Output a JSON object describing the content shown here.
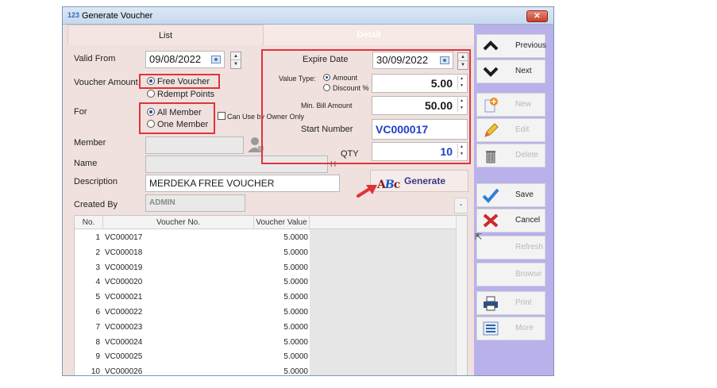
{
  "window": {
    "app_icon": "123",
    "title": "Generate Voucher",
    "close_label": "✕"
  },
  "tabs": [
    {
      "label": "List"
    },
    {
      "label": "Detail"
    }
  ],
  "form": {
    "valid_from_label": "Valid From",
    "valid_from": "09/08/2022",
    "voucher_amount_label": "Voucher Amount",
    "voucher_amount_options": [
      "Free Voucher",
      "Rdempt Points"
    ],
    "for_label": "For",
    "for_options": [
      "All Member",
      "One Member"
    ],
    "can_use_by_owner_label": "Can Use by Owner Only",
    "member_label": "Member",
    "member_value": "",
    "name_label": "Name",
    "name_value": "",
    "name_suffix": "H",
    "description_label": "Description",
    "description_value": "MERDEKA FREE VOUCHER",
    "created_by_label": "Created By",
    "created_by_value": "ADMIN"
  },
  "detail": {
    "expire_date_label": "Expire Date",
    "expire_date": "30/09/2022",
    "value_type_label": "Value Type:",
    "value_type_options": [
      "Amount",
      "Discount %"
    ],
    "value": "5.00",
    "min_bill_label": "Min. Bill Amount",
    "min_bill_value": "50.00",
    "start_number_label": "Start Number",
    "start_number_value": "VC000017",
    "qty_label": "QTY",
    "qty_value": "10",
    "generate_label": "Generate",
    "generate_icon_text": [
      "A",
      "B",
      "c"
    ]
  },
  "grid": {
    "columns": [
      "No.",
      "Voucher No.",
      "Voucher Value"
    ],
    "rows": [
      {
        "no": "1",
        "voucher_no": "VC000017",
        "value": "5.0000"
      },
      {
        "no": "2",
        "voucher_no": "VC000018",
        "value": "5.0000"
      },
      {
        "no": "3",
        "voucher_no": "VC000019",
        "value": "5.0000"
      },
      {
        "no": "4",
        "voucher_no": "VC000020",
        "value": "5.0000"
      },
      {
        "no": "5",
        "voucher_no": "VC000021",
        "value": "5.0000"
      },
      {
        "no": "6",
        "voucher_no": "VC000022",
        "value": "5.0000"
      },
      {
        "no": "7",
        "voucher_no": "VC000023",
        "value": "5.0000"
      },
      {
        "no": "8",
        "voucher_no": "VC000024",
        "value": "5.0000"
      },
      {
        "no": "9",
        "voucher_no": "VC000025",
        "value": "5.0000"
      },
      {
        "no": "10",
        "voucher_no": "VC000026",
        "value": "5.0000"
      }
    ],
    "collapse_label": "-"
  },
  "sidebar": {
    "previous": "Previous",
    "next": "Next",
    "new": "New",
    "edit": "Edit",
    "delete": "Delete",
    "save": "Save",
    "cancel": "Cancel",
    "refresh": "Refresh",
    "browse": "Browse",
    "print": "Print",
    "more": "More"
  },
  "colors": {
    "highlight_red": "#e0333a",
    "sidebar_bg": "#b8b1ea",
    "form_bg": "#f0e1de",
    "accent_blue": "#1f3fc9"
  },
  "icons": [
    "calendar-icon",
    "chevron-up-icon",
    "chevron-down-icon",
    "add-document-icon",
    "pencil-icon",
    "trash-icon",
    "checkmark-icon",
    "red-x-icon",
    "printer-icon",
    "list-icon",
    "person-silhouette-icon"
  ]
}
